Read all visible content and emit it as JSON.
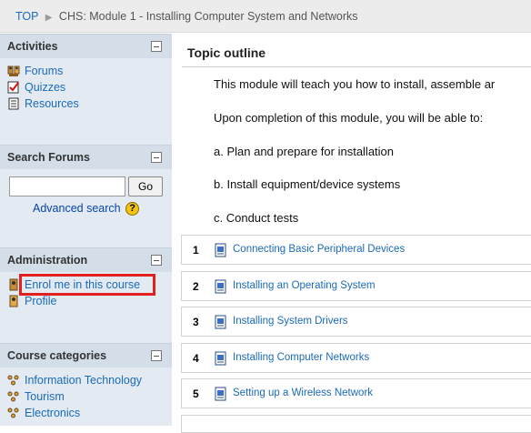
{
  "breadcrumb": {
    "top_label": "TOP",
    "separator": "▶",
    "current": "CHS: Module 1 - Installing Computer System and Networks"
  },
  "sidebar": {
    "activities": {
      "title": "Activities",
      "items": [
        {
          "label": "Forums",
          "icon": "forum-icon"
        },
        {
          "label": "Quizzes",
          "icon": "quiz-icon"
        },
        {
          "label": "Resources",
          "icon": "resource-icon"
        }
      ]
    },
    "search_forums": {
      "title": "Search Forums",
      "input_value": "",
      "go_label": "Go",
      "advanced_label": "Advanced search",
      "help_glyph": "?"
    },
    "administration": {
      "title": "Administration",
      "items": [
        {
          "label": "Enrol me in this course",
          "icon": "enrol-icon",
          "highlighted": true
        },
        {
          "label": "Profile",
          "icon": "profile-icon"
        }
      ]
    },
    "course_categories": {
      "title": "Course categories",
      "items": [
        {
          "label": "Information Technology",
          "icon": "category-icon"
        },
        {
          "label": "Tourism",
          "icon": "category-icon"
        },
        {
          "label": "Electronics",
          "icon": "category-icon"
        }
      ]
    }
  },
  "main": {
    "title": "Topic outline",
    "summary": [
      "This module will teach you how to install, assemble ar",
      "Upon completion of this module, you will be able to:",
      "a. Plan and prepare for installation",
      "b. Install equipment/device systems",
      "c. Conduct tests"
    ],
    "sections": [
      {
        "num": "1",
        "label": "Connecting Basic Peripheral Devices"
      },
      {
        "num": "2",
        "label": "Installing an Operating System"
      },
      {
        "num": "3",
        "label": "Installing System Drivers"
      },
      {
        "num": "4",
        "label": "Installing Computer Networks"
      },
      {
        "num": "5",
        "label": "Setting up a Wireless Network"
      }
    ]
  },
  "colors": {
    "link": "#1b6bb8",
    "sidebar_bg": "#e3eaf1",
    "block_header_bg": "#d3dee9",
    "highlight_border": "#e32020"
  }
}
